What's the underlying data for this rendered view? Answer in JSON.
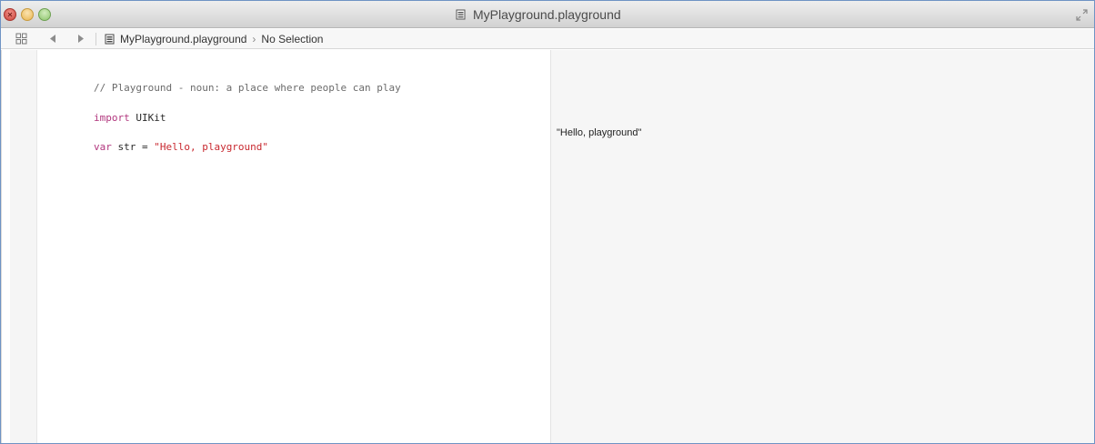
{
  "window": {
    "title": "MyPlayground.playground",
    "title_icon": "playground-doc-icon",
    "accent_border": "#6f93c4"
  },
  "toolbar": {
    "breadcrumb": [
      {
        "label": "MyPlayground.playground",
        "icon": "playground-doc-icon"
      },
      {
        "label": "No Selection"
      }
    ],
    "icons": [
      "related-items-icon",
      "back-arrow-icon",
      "forward-arrow-icon"
    ]
  },
  "editor": {
    "lines": [
      {
        "comment": "// Playground - noun: a place where people can play"
      },
      {
        "keyword": "import",
        "plain": " UIKit"
      },
      {
        "keyword": "var",
        "plain": " str = ",
        "string": "\"Hello, playground\""
      }
    ]
  },
  "results": {
    "values": [
      "\"Hello, playground\""
    ]
  },
  "colors": {
    "comment": "#6b6b6b",
    "keyword": "#b2377e",
    "string": "#c8282f",
    "results_background": "#f6f6f6"
  }
}
